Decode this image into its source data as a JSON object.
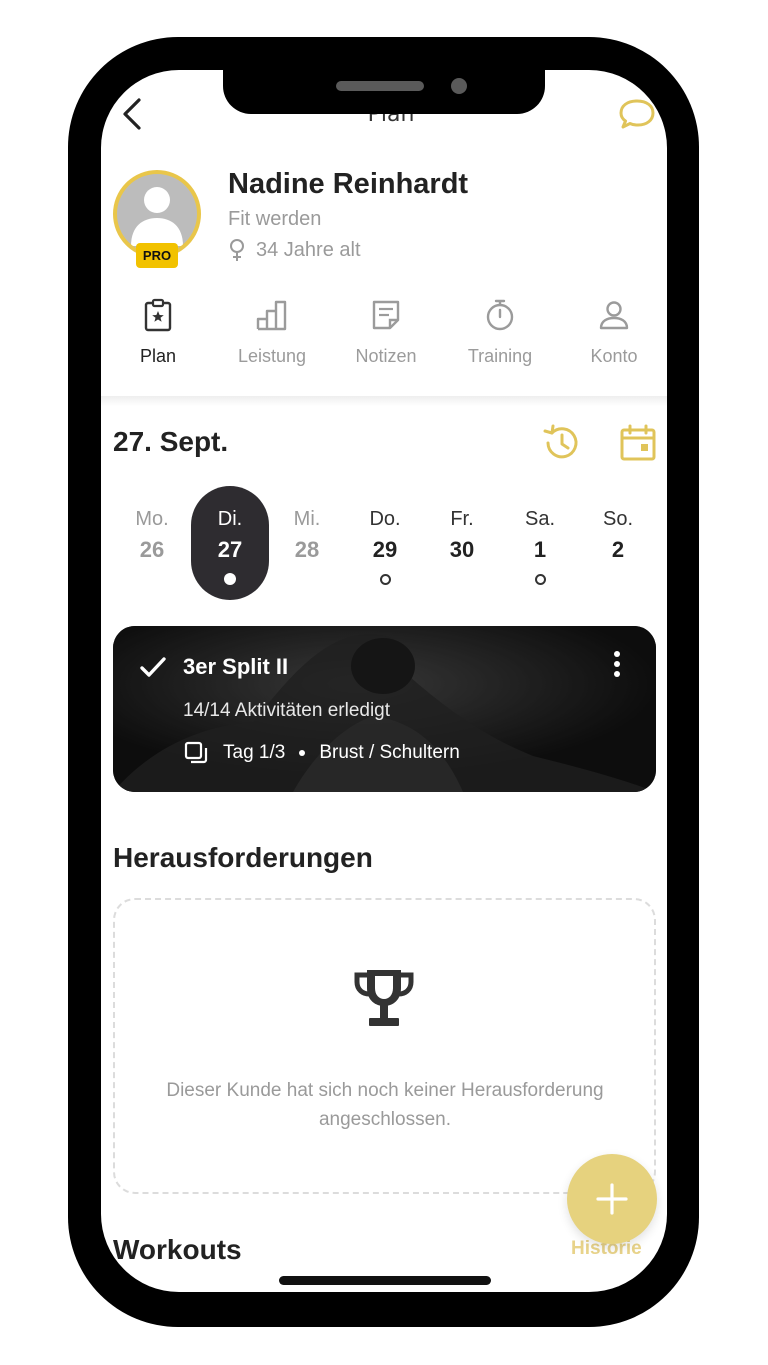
{
  "header": {
    "title": "Plan"
  },
  "profile": {
    "name": "Nadine Reinhardt",
    "goal": "Fit werden",
    "age": "34 Jahre alt",
    "badge": "PRO"
  },
  "tabs": [
    {
      "label": "Plan",
      "icon": "clipboard-star-icon",
      "active": true
    },
    {
      "label": "Leistung",
      "icon": "bar-chart-icon",
      "active": false
    },
    {
      "label": "Notizen",
      "icon": "note-icon",
      "active": false
    },
    {
      "label": "Training",
      "icon": "stopwatch-icon",
      "active": false
    },
    {
      "label": "Konto",
      "icon": "person-icon",
      "active": false
    }
  ],
  "date": {
    "title": "27. Sept."
  },
  "week": [
    {
      "name": "Mo.",
      "num": "26",
      "state": "past"
    },
    {
      "name": "Di.",
      "num": "27",
      "state": "selected"
    },
    {
      "name": "Mi.",
      "num": "28",
      "state": "past"
    },
    {
      "name": "Do.",
      "num": "29",
      "state": "future"
    },
    {
      "name": "Fr.",
      "num": "30",
      "state": "future"
    },
    {
      "name": "Sa.",
      "num": "1",
      "state": "future"
    },
    {
      "name": "So.",
      "num": "2",
      "state": "future"
    }
  ],
  "workout_card": {
    "title": "3er Split II",
    "progress": "14/14 Aktivitäten erledigt",
    "day": "Tag 1/3",
    "focus": "Brust / Schultern"
  },
  "challenges": {
    "title": "Herausforderungen",
    "empty_text": "Dieser Kunde hat sich noch keiner Herausforderung angeschlossen."
  },
  "workouts": {
    "title": "Workouts",
    "history_label": "Historie"
  },
  "colors": {
    "accent": "#e9c64a",
    "badge": "#f2c200",
    "selected_day": "#2e2c30",
    "fab": "#e6d27e"
  }
}
